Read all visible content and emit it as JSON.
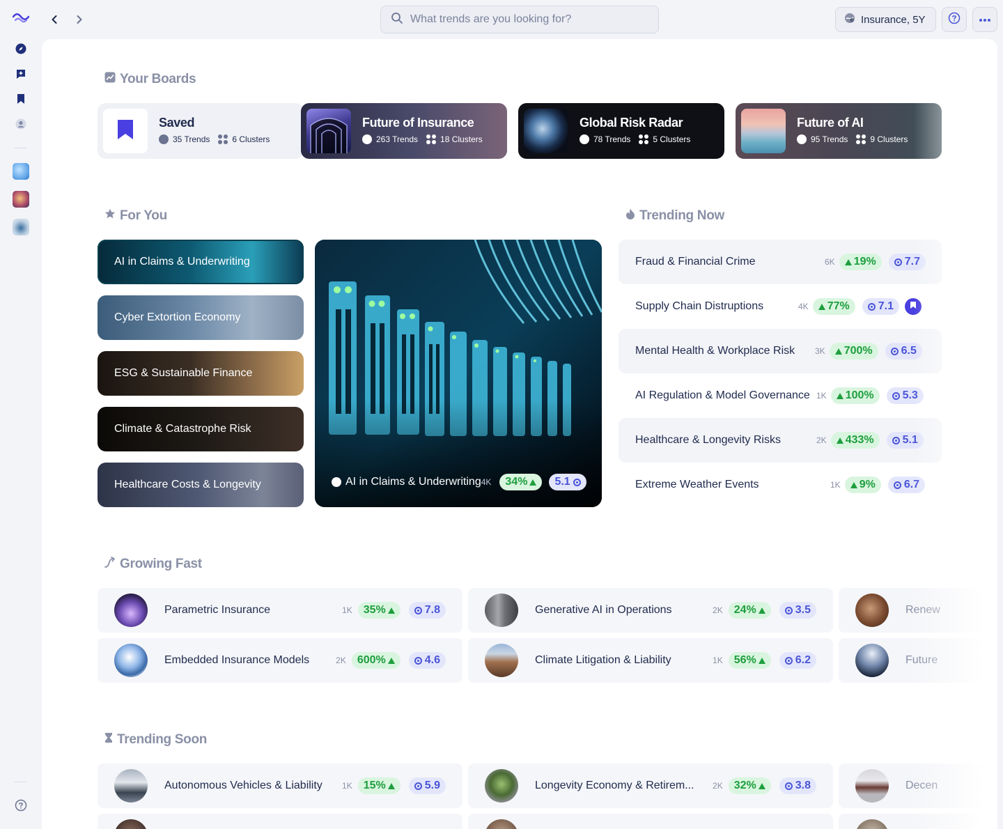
{
  "search": {
    "placeholder": "What trends are you looking for?"
  },
  "context": {
    "label": "Insurance, 5Y"
  },
  "sections": {
    "boards": "Your Boards",
    "for_you": "For You",
    "trending_now": "Trending Now",
    "growing_fast": "Growing Fast",
    "trending_soon": "Trending Soon"
  },
  "boards": [
    {
      "title": "Saved",
      "trends": "35 Trends",
      "clusters": "6 Clusters"
    },
    {
      "title": "Future of Insurance",
      "trends": "263 Trends",
      "clusters": "18 Clusters"
    },
    {
      "title": "Global Risk Radar",
      "trends": "78 Trends",
      "clusters": "5 Clusters"
    },
    {
      "title": "Future of AI",
      "trends": "95 Trends",
      "clusters": "9 Clusters"
    }
  ],
  "for_you": [
    "AI in Claims & Underwriting",
    "Cyber Extortion Economy",
    "ESG & Sustainable Finance",
    "Climate & Catastrophe Risk",
    "Healthcare Costs & Longevity"
  ],
  "hero": {
    "title": "AI in Claims & Underwriting",
    "count": "4K",
    "growth": "34%",
    "score": "5.1"
  },
  "trending_now": [
    {
      "name": "Fraud & Financial Crime",
      "count": "6K",
      "growth": "19%",
      "score": "7.7"
    },
    {
      "name": "Supply Chain Distruptions",
      "count": "4K",
      "growth": "77%",
      "score": "7.1"
    },
    {
      "name": "Mental Health & Workplace Risk",
      "count": "3K",
      "growth": "700%",
      "score": "6.5"
    },
    {
      "name": "AI Regulation & Model Governance",
      "count": "1K",
      "growth": "100%",
      "score": "5.3"
    },
    {
      "name": "Healthcare & Longevity Risks",
      "count": "2K",
      "growth": "433%",
      "score": "5.1"
    },
    {
      "name": "Extreme Weather Events",
      "count": "1K",
      "growth": "9%",
      "score": "6.7"
    }
  ],
  "growing_fast": [
    {
      "name": "Parametric Insurance",
      "count": "1K",
      "growth": "35%",
      "score": "7.8"
    },
    {
      "name": "Generative AI in Operations",
      "count": "2K",
      "growth": "24%",
      "score": "3.5"
    },
    {
      "name": "Renew",
      "count": "",
      "growth": "",
      "score": ""
    },
    {
      "name": "Embedded Insurance Models",
      "count": "2K",
      "growth": "600%",
      "score": "4.6"
    },
    {
      "name": "Climate Litigation & Liability",
      "count": "1K",
      "growth": "56%",
      "score": "6.2"
    },
    {
      "name": "Future",
      "count": "",
      "growth": "",
      "score": ""
    }
  ],
  "trending_soon": [
    {
      "name": "Autonomous Vehicles & Liability",
      "count": "1K",
      "growth": "15%",
      "score": "5.9"
    },
    {
      "name": "Longevity Economy & Retirem...",
      "count": "2K",
      "growth": "32%",
      "score": "3.8"
    },
    {
      "name": "Decen",
      "count": "",
      "growth": "",
      "score": ""
    }
  ],
  "colors": {
    "accent": "#4a3fe0",
    "growth_green": "#1e9e3e",
    "score_blue": "#4a54d6"
  }
}
